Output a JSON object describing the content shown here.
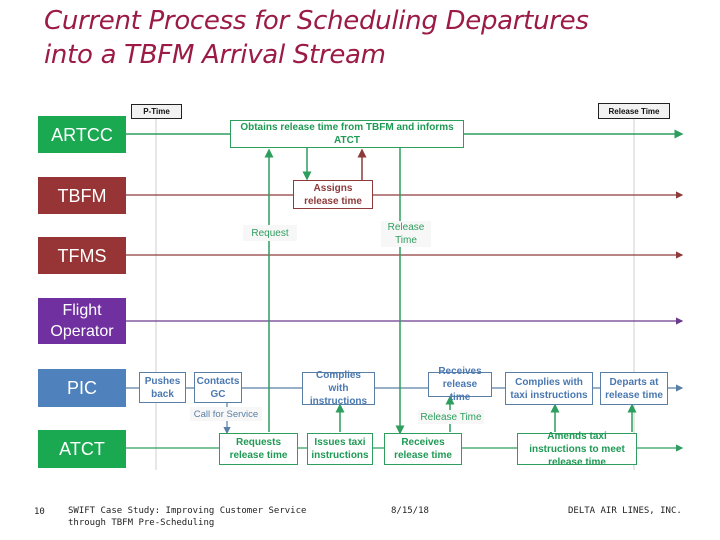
{
  "slide": {
    "title_line1": "Current Process for Scheduling Departures",
    "title_line2": "into a TBFM Arrival Stream"
  },
  "colors": {
    "title": "#9b1b45",
    "artcc": "#1aa851",
    "tbfm": "#973435",
    "tfms": "#973435",
    "flight_operator": "#7030a0",
    "pic": "#4f81bd",
    "atct": "#1aa851",
    "green_line": "#2e9e5e",
    "maroon_line": "#8e3a3a",
    "purple_line": "#6a3a8e",
    "blue_line": "#5a7fa6"
  },
  "lanes": [
    {
      "id": "artcc",
      "label": "ARTCC"
    },
    {
      "id": "tbfm",
      "label": "TBFM"
    },
    {
      "id": "tfms",
      "label": "TFMS"
    },
    {
      "id": "flight_operator",
      "label": "Flight Operator"
    },
    {
      "id": "pic",
      "label": "PIC"
    },
    {
      "id": "atct",
      "label": "ATCT"
    }
  ],
  "time_markers": {
    "p_time": "P-Time",
    "release_time": "Release Time"
  },
  "boxes": {
    "obtains": "Obtains release time from TBFM and informs ATCT",
    "assigns": "Assigns release time",
    "pushes_back": "Pushes back",
    "contacts_gc": "Contacts GC",
    "complies_instructions": "Complies with instructions",
    "receives_release_pic": "Receives release time",
    "complies_taxi": "Complies with taxi instructions",
    "departs": "Departs at release time",
    "requests_release": "Requests release time",
    "issues_taxi": "Issues taxi instructions",
    "receives_release_atct": "Receives release time",
    "amends_taxi": "Amends taxi instructions to meet release time"
  },
  "notes": {
    "request": "Request",
    "release_time_upper": "Release Time",
    "call_for_service": "Call for Service",
    "release_time_lower": "Release Time"
  },
  "footer": {
    "page_number": "10",
    "case_study_line1": "SWIFT Case Study: Improving Customer Service",
    "case_study_line2": "through TBFM Pre-Scheduling",
    "date": "8/15/18",
    "company": "DELTA AIR LINES, INC."
  }
}
